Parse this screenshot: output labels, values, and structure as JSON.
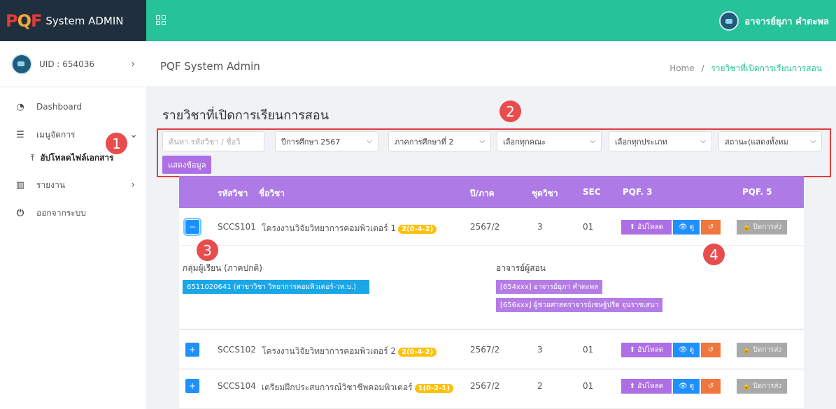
{
  "app": {
    "logo_letters": [
      "P",
      "Q",
      "F"
    ],
    "title": "System ADMIN",
    "user_name": "อาจารย์ยุภา คำตะพล"
  },
  "sidebar": {
    "uid": "UID : 654036",
    "items": [
      {
        "label": "Dashboard",
        "icon": "gauge-icon"
      },
      {
        "label": "เมนูจัดการ",
        "icon": "list-icon"
      },
      {
        "label": "อัปโหลดไฟล์เอกสาร",
        "icon": "upload-icon"
      },
      {
        "label": "รายงาน",
        "icon": "chart-icon"
      },
      {
        "label": "ออกจากระบบ",
        "icon": "power-icon"
      }
    ]
  },
  "header": {
    "title": "PQF System Admin",
    "breadcrumb_home": "Home",
    "breadcrumb_sep": "/",
    "breadcrumb_current": "รายวิชาที่เปิดการเรียนการสอน"
  },
  "page": {
    "heading": "รายวิชาที่เปิดการเรียนการสอน"
  },
  "filters": {
    "search_placeholder": "ค้นหา รหัสวิชา / ชื่อวิ",
    "year": "ปีการศึกษา 2567",
    "term": "ภาคการศึกษาที่ 2",
    "faculty": "เลือกทุกคณะ",
    "type": "เลือกทุกประเภท",
    "status": "สถานะ(แสดงทั้งหม",
    "show_button": "แสดงข้อมูล"
  },
  "markers": [
    "1",
    "2",
    "3",
    "4"
  ],
  "table": {
    "headers": {
      "code": "รหัสวิชา",
      "name": "ชื่อวิชา",
      "term": "ปี/ภาค",
      "set": "ชุดวิชา",
      "sec": "SEC",
      "pqf3": "PQF. 3",
      "pqf5": "PQF. 5"
    },
    "rows": [
      {
        "toggle": "−",
        "code": "SCCS101",
        "name": "โครงงานวิจัยวิทยาการคอมพิวเตอร์ 1",
        "credit": "2(0-4-2)",
        "term": "2567/2",
        "set": "3",
        "sec": "01"
      },
      {
        "toggle": "+",
        "code": "SCCS102",
        "name": "โครงงานวิจัยวิทยาการคอมพิวเตอร์ 2",
        "credit": "2(0-4-2)",
        "term": "2567/2",
        "set": "3",
        "sec": "01"
      },
      {
        "toggle": "+",
        "code": "SCCS104",
        "name": "เตรียมฝึกประสบการณ์วิชาชีพคอมพิวเตอร์",
        "credit": "1(0-2-1)",
        "term": "2567/2",
        "set": "2",
        "sec": "01"
      }
    ],
    "buttons": {
      "upload": "⬆ อัปโหลด",
      "view": "👁 ดู",
      "undo": "↺",
      "close": "🔒 ปิดการส่ง"
    },
    "detail": {
      "group_label": "กลุ่มผู้เรียน (ภาคปกติ)",
      "group_value": "6511020641 (สาขาวิชา วิทยาการคอมพิวเตอร์-วท.บ.)",
      "teacher_label": "อาจารย์ผู้สอน",
      "teachers": [
        "[654xxx] อาจารย์ยุภา คำตะพล",
        "[656xxx] ผู้ช่วยศาสตราจารย์เชษฐ์ปรีด จุนราชเสนา"
      ]
    }
  }
}
